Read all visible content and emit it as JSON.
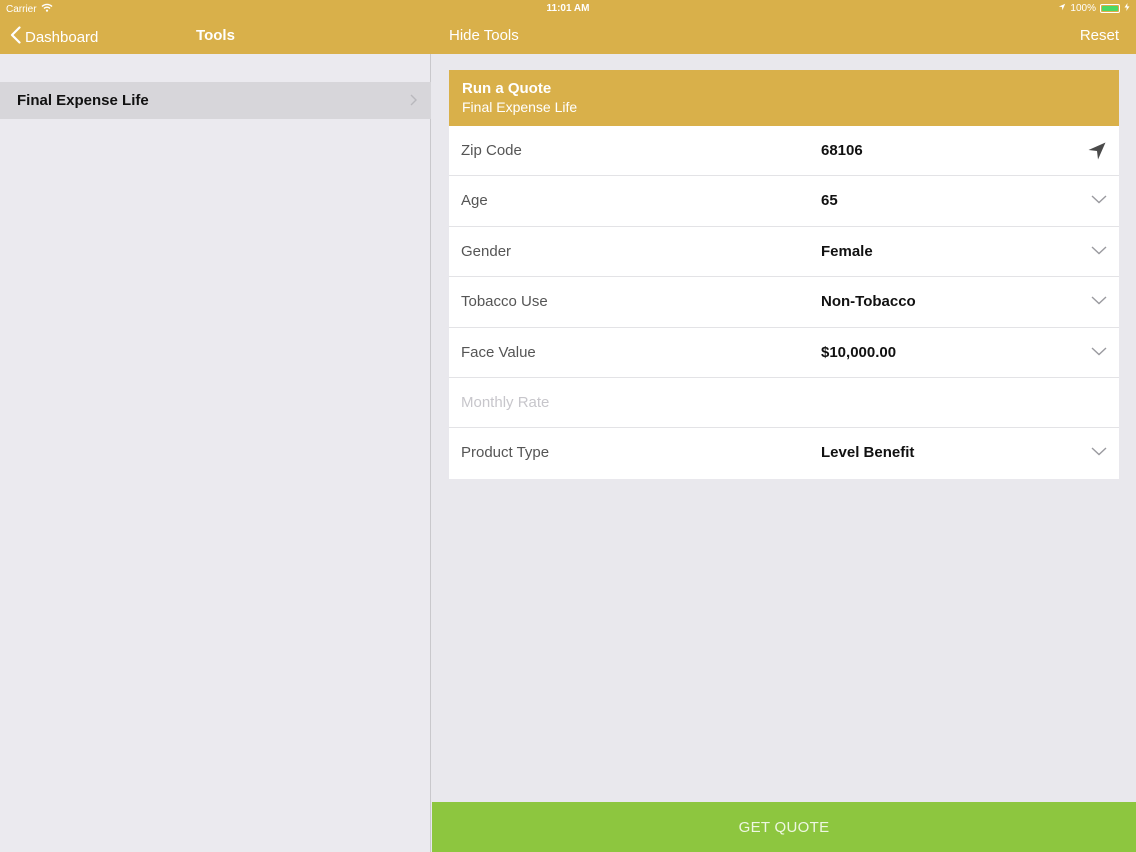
{
  "status_bar": {
    "carrier": "Carrier",
    "time": "11:01 AM",
    "battery": "100%"
  },
  "nav": {
    "back_label": "Dashboard",
    "title": "Tools",
    "hide_tools": "Hide Tools",
    "reset": "Reset"
  },
  "sidebar": {
    "items": [
      {
        "label": "Final Expense Life"
      }
    ]
  },
  "quote": {
    "title": "Run a Quote",
    "subtitle": "Final Expense Life",
    "rows": [
      {
        "label": "Zip Code",
        "value": "68106",
        "icon": "location-arrow-icon"
      },
      {
        "label": "Age",
        "value": "65",
        "icon": "chevron-down-icon"
      },
      {
        "label": "Gender",
        "value": "Female",
        "icon": "chevron-down-icon"
      },
      {
        "label": "Tobacco Use",
        "value": "Non-Tobacco",
        "icon": "chevron-down-icon"
      },
      {
        "label": "Face Value",
        "value": "$10,000.00",
        "icon": "chevron-down-icon"
      },
      {
        "label": "Monthly Rate",
        "value": ""
      },
      {
        "label": "Product Type",
        "value": "Level Benefit",
        "icon": "chevron-down-icon"
      }
    ]
  },
  "action": {
    "get_quote": "GET QUOTE"
  },
  "colors": {
    "header": "#d9b04a",
    "button": "#8dc63f",
    "background": "#e9e8ed"
  }
}
